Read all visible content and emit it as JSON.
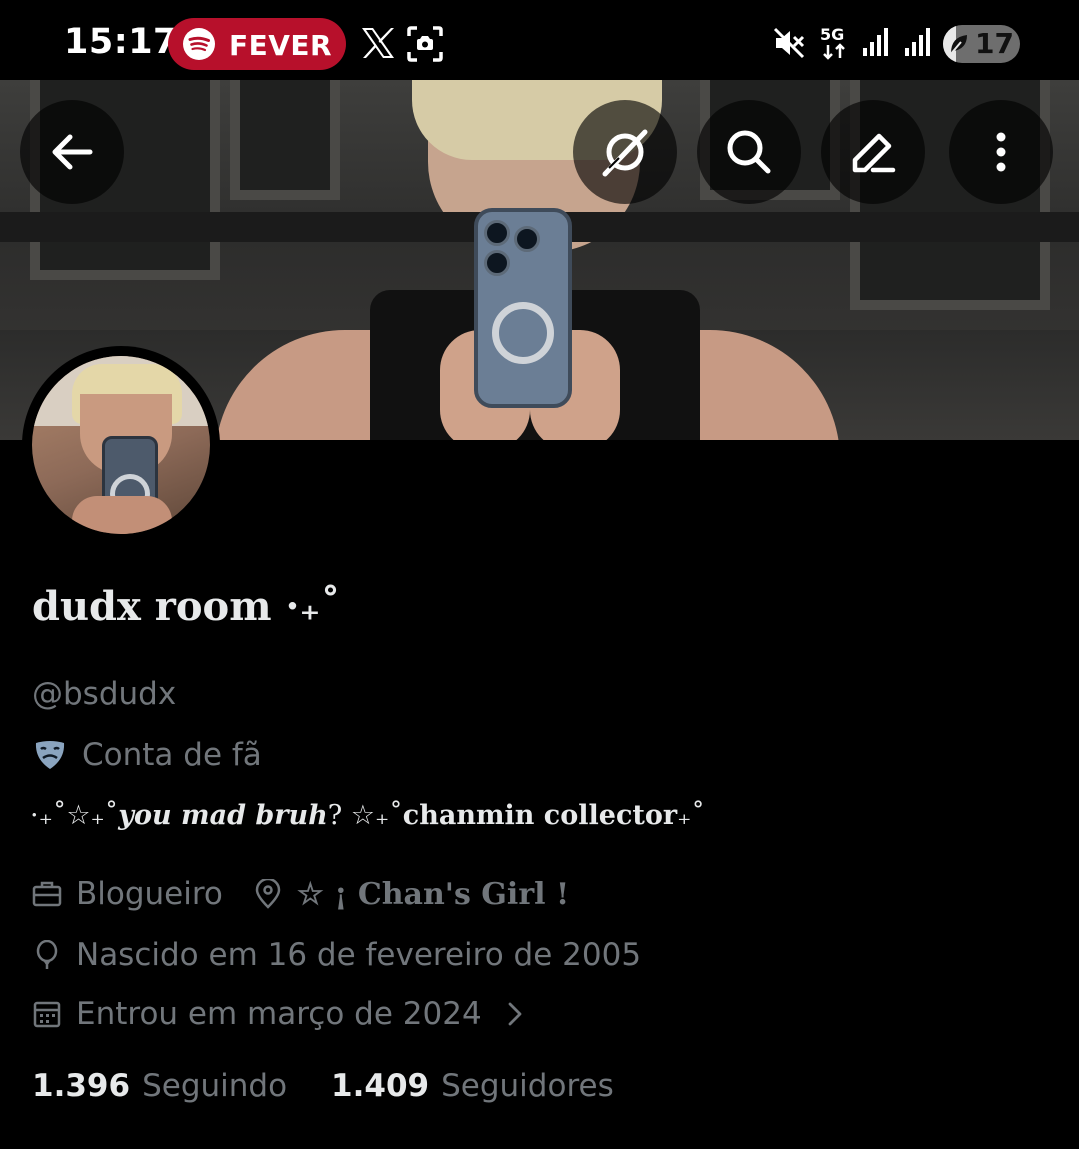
{
  "status_bar": {
    "time": "15:17",
    "now_playing_app": "FEVER",
    "battery_level": "17",
    "battery_fraction": 0.17
  },
  "header": {
    "back_icon": "arrow-left-icon",
    "buttons": [
      "grok-icon",
      "search-icon",
      "edit-icon",
      "more-vertical-icon"
    ]
  },
  "profile": {
    "display_name": "dudx room ·₊˚",
    "handle": "@bsdudx",
    "label": "Conta de fã",
    "bio_part1": "·₊˚☆₊˚",
    "bio_italic": "you mad bruh",
    "bio_part2": "? ☆₊˚",
    "bio_bold": "chanmin collector",
    "bio_part3": "₊˚",
    "profession": "Blogueiro",
    "location": "☆ ¡ Chan's Girl !",
    "birthday": "Nascido em 16 de fevereiro de 2005",
    "joined": "Entrou em março de 2024",
    "following_count": "1.396",
    "following_label": "Seguindo",
    "followers_count": "1.409",
    "followers_label": "Seguidores"
  },
  "colors": {
    "background": "#000000",
    "primary_text": "#e7e9ea",
    "secondary_text": "#71767b",
    "spotify_pill": "#b7102b"
  }
}
